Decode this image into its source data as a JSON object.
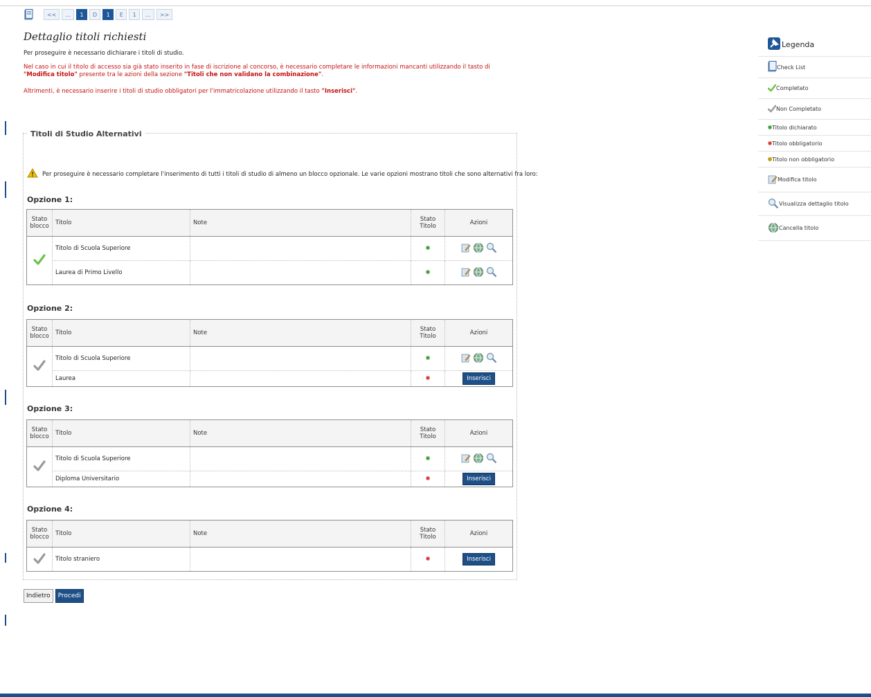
{
  "pager": {
    "items": [
      "<<",
      "...",
      "1",
      "D",
      "1",
      "E",
      "1",
      "...",
      ">>"
    ]
  },
  "page": {
    "title": "Dettaglio titoli richiesti",
    "intro": "Per proseguire è necessario dichiarare i titoli di studio.",
    "red1_a": "Nel caso in cui il titolo di accesso sia già stato inserito in fase di iscrizione al concorso, è necessario completare le informazioni mancanti utilizzando il tasto di ",
    "red1_b": "\"Modifica titolo\"",
    "red1_c": " presente tra le azioni della sezione ",
    "red1_d": "\"Titoli che non validano la combinazione\"",
    "red1_e": ".",
    "red2_a": "Altrimenti, è necessario inserire i titoli di studio obbligatori per l'immatricolazione utilizzando il tasto ",
    "red2_b": "\"Inserisci\"",
    "red2_c": "."
  },
  "section": {
    "title": "Titoli di Studio Alternativi",
    "warning": "Per proseguire è necessario completare l'inserimento di tutti i titoli di studio di almeno un blocco opzionale. Le varie opzioni mostrano titoli che sono alternativi fra loro:"
  },
  "table_headers": {
    "stato_blocco_1": "Stato",
    "stato_blocco_2": "blocco",
    "titolo": "Titolo",
    "note": "Note",
    "stato_titolo_1": "Stato",
    "stato_titolo_2": "Titolo",
    "azioni": "Azioni"
  },
  "options": [
    {
      "label": "Opzione 1:",
      "block_status": "completato",
      "rows": [
        {
          "titolo": "Titolo di Scuola Superiore",
          "note": "",
          "status": "green",
          "action": "icons"
        },
        {
          "titolo": "Laurea di Primo Livello",
          "note": "",
          "status": "green",
          "action": "icons"
        }
      ]
    },
    {
      "label": "Opzione 2:",
      "block_status": "non-completato",
      "rows": [
        {
          "titolo": "Titolo di Scuola Superiore",
          "note": "",
          "status": "green",
          "action": "icons"
        },
        {
          "titolo": "Laurea",
          "note": "",
          "status": "red",
          "action": "Inserisci"
        }
      ]
    },
    {
      "label": "Opzione 3:",
      "block_status": "non-completato",
      "rows": [
        {
          "titolo": "Titolo di Scuola Superiore",
          "note": "",
          "status": "green",
          "action": "icons"
        },
        {
          "titolo": "Diploma Universitario",
          "note": "",
          "status": "red",
          "action": "Inserisci"
        }
      ]
    },
    {
      "label": "Opzione 4:",
      "block_status": "non-completato",
      "rows": [
        {
          "titolo": "Titolo straniero",
          "note": "",
          "status": "red",
          "action": "Inserisci"
        }
      ]
    }
  ],
  "buttons": {
    "back": "Indietro",
    "next": "Procedi",
    "insert": "Inserisci"
  },
  "legend": {
    "title": "Legenda",
    "items": [
      {
        "label": "Check List",
        "icon": "checklist-icon"
      },
      {
        "label": "Completato",
        "icon": "green-check-icon"
      },
      {
        "label": "Non Completato",
        "icon": "gray-check-icon"
      },
      {
        "label": "Titolo dichiarato",
        "icon": "green-dot-icon"
      },
      {
        "label": "Titolo obbligatorio",
        "icon": "red-dot-icon"
      },
      {
        "label": "Titolo non obbligatorio",
        "icon": "yellow-dot-icon"
      },
      {
        "label": "Modifica titolo",
        "icon": "edit-icon"
      },
      {
        "label": "Visualizza dettaglio titolo",
        "icon": "magnifier-icon"
      },
      {
        "label": "Cancella titolo",
        "icon": "globe-delete-icon"
      }
    ]
  },
  "colors": {
    "accent": "#1e4f86",
    "red_text": "#c41212",
    "status_green": "#3e9a3e",
    "status_red": "#d23333",
    "status_yellow": "#c9a21a"
  }
}
